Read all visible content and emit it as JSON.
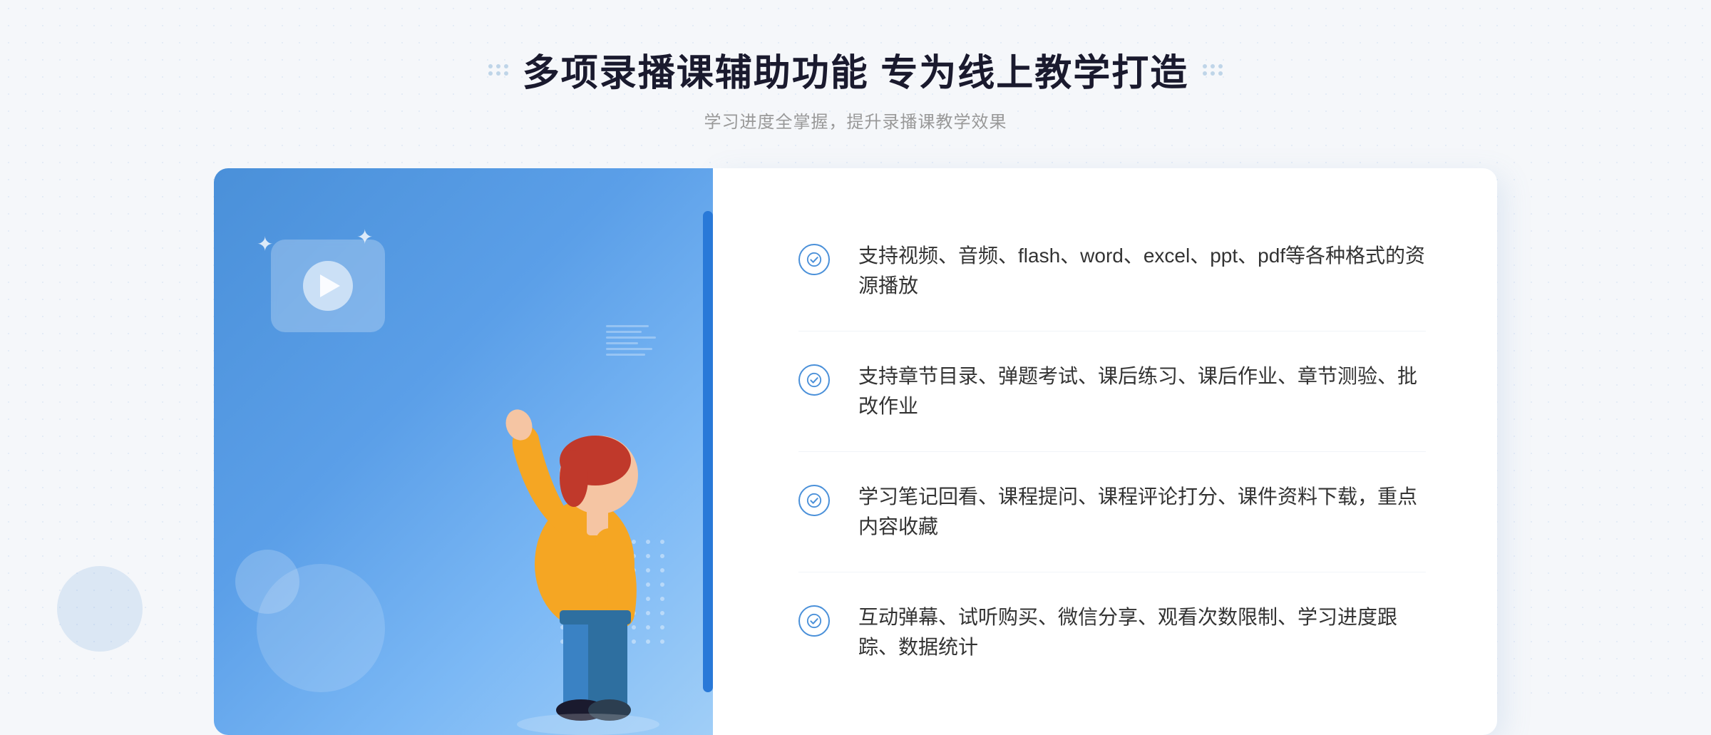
{
  "header": {
    "title": "多项录播课辅助功能 专为线上教学打造",
    "subtitle": "学习进度全掌握，提升录播课教学效果"
  },
  "features": [
    {
      "id": "feature-1",
      "text": "支持视频、音频、flash、word、excel、ppt、pdf等各种格式的资源播放"
    },
    {
      "id": "feature-2",
      "text": "支持章节目录、弹题考试、课后练习、课后作业、章节测验、批改作业"
    },
    {
      "id": "feature-3",
      "text": "学习笔记回看、课程提问、课程评论打分、课件资料下载，重点内容收藏"
    },
    {
      "id": "feature-4",
      "text": "互动弹幕、试听购买、微信分享、观看次数限制、学习进度跟踪、数据统计"
    }
  ],
  "decorative": {
    "left_arrow": "»"
  }
}
